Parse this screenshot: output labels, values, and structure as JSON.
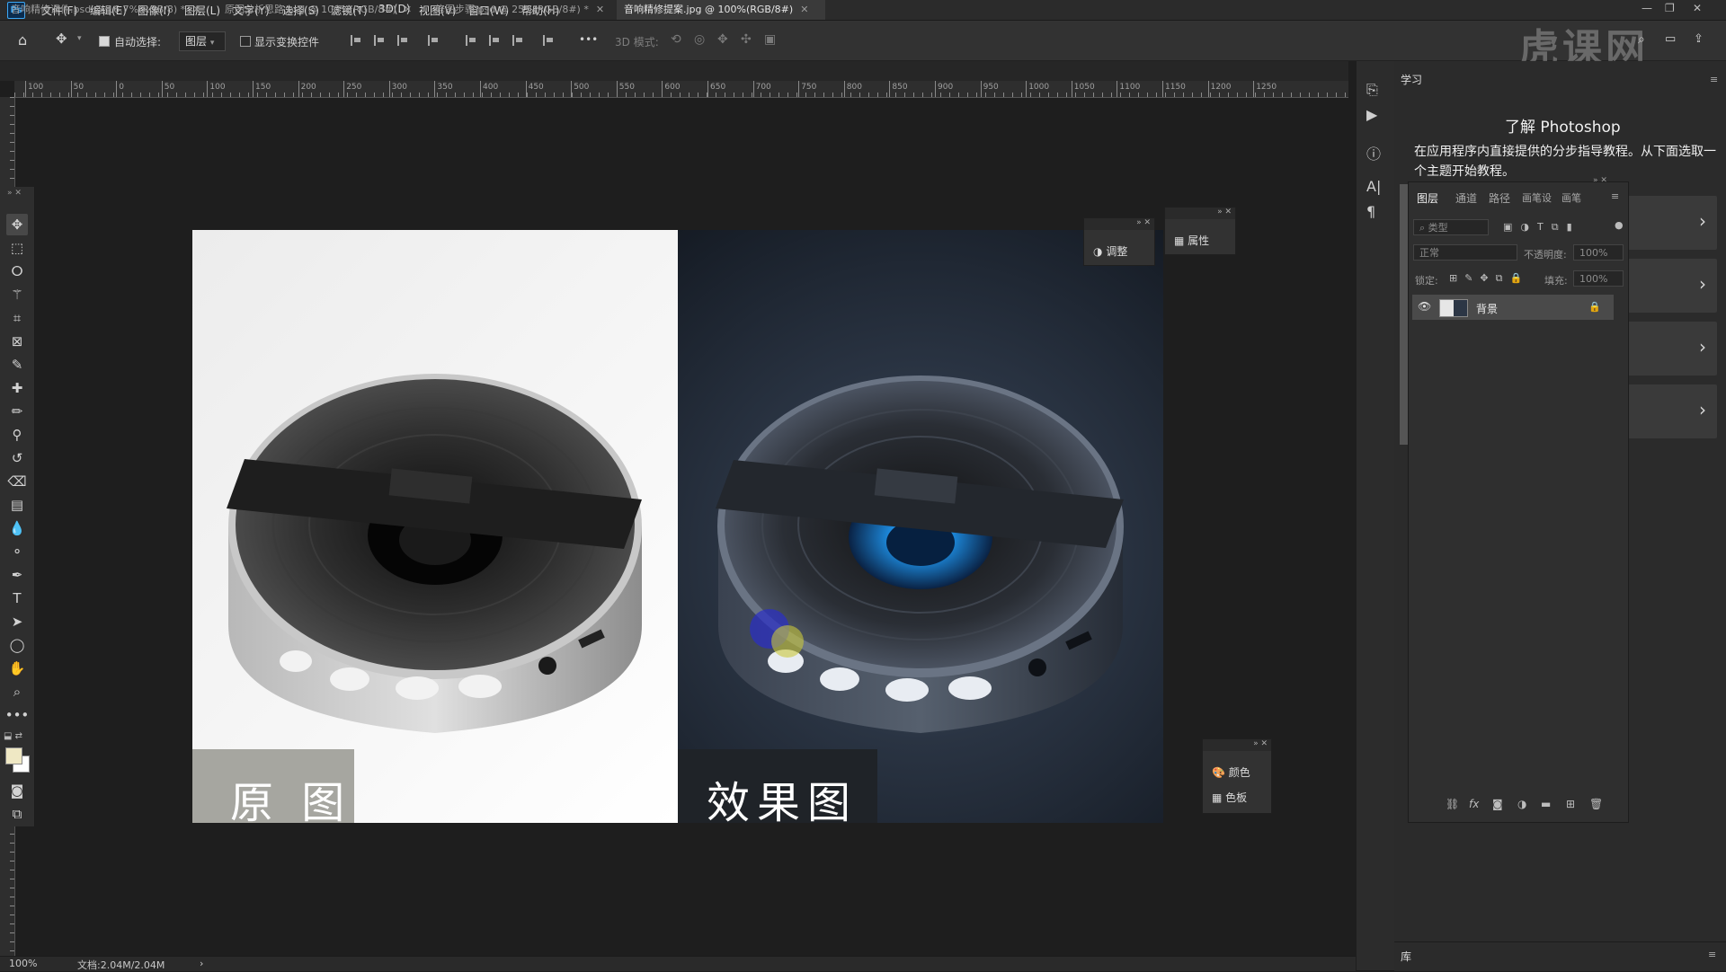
{
  "app": {
    "logo": "Ps"
  },
  "menu": [
    "文件(F)",
    "编辑(E)",
    "图像(I)",
    "图层(L)",
    "文字(Y)",
    "选择(S)",
    "滤镜(T)",
    "3D(D)",
    "视图(V)",
    "窗口(W)",
    "帮助(H)"
  ],
  "options": {
    "auto_select_label": "自动选择:",
    "auto_select_value": "图层",
    "show_transform_label": "显示变换控件",
    "more": "•••",
    "mode_3d_label": "3D 模式:"
  },
  "tabs": [
    {
      "label": "音响精修课件.psd @ 16.7%(RGB/8) *"
    },
    {
      "label": "原图分析思路.psd @ 100%(RGB/8#)"
    },
    {
      "label": "修图步骤.psd @ 25%(RGB/8#) *"
    },
    {
      "label": "音响精修提案.jpg @ 100%(RGB/8#)"
    }
  ],
  "ruler_labels": [
    "100",
    "50",
    "0",
    "50",
    "100",
    "150",
    "200",
    "250",
    "300",
    "350",
    "400",
    "450",
    "500",
    "550",
    "600",
    "650",
    "700",
    "750",
    "800",
    "850",
    "900",
    "950",
    "1000",
    "1050",
    "1100",
    "1150",
    "1200",
    "1250"
  ],
  "canvas": {
    "original_label": "原 图",
    "effect_label": "效果图"
  },
  "floating_panels": {
    "adjust": "调整",
    "properties": "属性",
    "color": "颜色",
    "swatches": "色板"
  },
  "learn": {
    "tab": "学习",
    "title": "了解 Photoshop",
    "desc": "在应用程序内直接提供的分步指导教程。从下面选取一个主题开始教程。"
  },
  "layers": {
    "tabs": [
      "图层",
      "通道",
      "路径",
      "画笔设",
      "画笔"
    ],
    "filter_placeholder": "类型",
    "blend_mode": "正常",
    "opacity_label": "不透明度:",
    "opacity_value": "100%",
    "lock_label": "锁定:",
    "fill_label": "填充:",
    "fill_value": "100%",
    "layer_name": "背景"
  },
  "status": {
    "zoom": "100%",
    "doc": "文档:2.04M/2.04M",
    "library": "库"
  },
  "watermark": "虎课网"
}
